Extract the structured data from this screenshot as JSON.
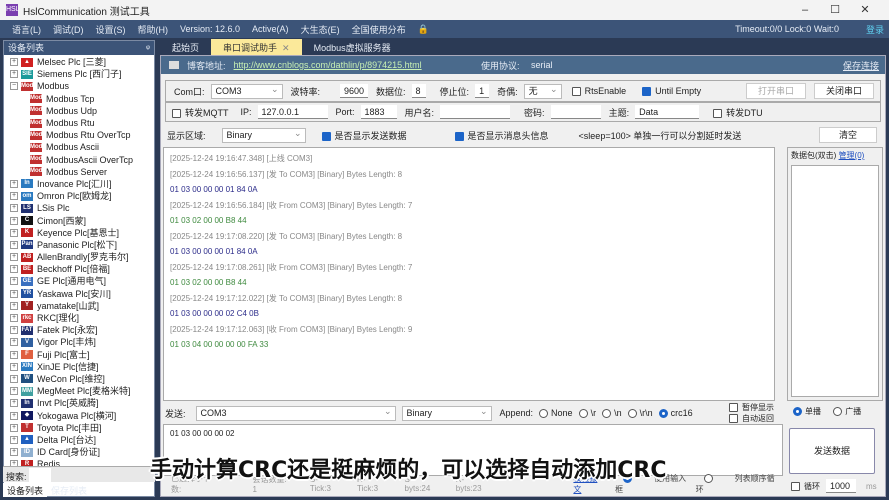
{
  "window": {
    "title": "HslCommunication 测试工具",
    "logo": "HSL",
    "minimize": "–",
    "maximize": "☐",
    "close": "✕"
  },
  "menu": {
    "items": [
      "语言(L)",
      "调试(D)",
      "设置(S)",
      "帮助(H)",
      "Version: 12.6.0",
      "Active(A)",
      "大生态(E)",
      "全国使用分布"
    ],
    "lock_icon": "🔒",
    "status": "Timeout:0/0  Lock:0  Wait:0",
    "login": "登录"
  },
  "tabs": [
    {
      "label": "起始页"
    },
    {
      "label": "串口调试助手",
      "close": "✕"
    },
    {
      "label": "Modbus虚拟服务器"
    }
  ],
  "left_panel": {
    "title": "设备列表",
    "pin": "ᵠ",
    "tree": [
      {
        "label": "Melsec Plc [三菱]",
        "exp": "+",
        "icon": "▲",
        "color": "#d02020"
      },
      {
        "label": "Siemens Plc [西门子]",
        "exp": "+",
        "icon": "SIE",
        "color": "#1a9a9a"
      },
      {
        "label": "Modbus",
        "exp": "−",
        "icon": "Mod",
        "color": "#c03030"
      },
      {
        "label": "Modbus Tcp",
        "child": true,
        "icon": "Mod",
        "color": "#c03030"
      },
      {
        "label": "Modbus Udp",
        "child": true,
        "icon": "Mod",
        "color": "#c03030"
      },
      {
        "label": "Modbus Rtu",
        "child": true,
        "icon": "Mod",
        "color": "#c03030"
      },
      {
        "label": "Modbus Rtu OverTcp",
        "child": true,
        "icon": "Mod",
        "color": "#c03030"
      },
      {
        "label": "Modbus Ascii",
        "child": true,
        "icon": "Mod",
        "color": "#c03030"
      },
      {
        "label": "ModbusAscii OverTcp",
        "child": true,
        "icon": "Mod",
        "color": "#c03030"
      },
      {
        "label": "Modbus Server",
        "child": true,
        "icon": "Mod",
        "color": "#c03030"
      },
      {
        "label": "Inovance Plc[汇川]",
        "exp": "+",
        "icon": "In",
        "color": "#2a7ac0"
      },
      {
        "label": "Omron Plc[欧姆龙]",
        "exp": "+",
        "icon": "om",
        "color": "#2a7ac0"
      },
      {
        "label": "LSis Plc",
        "exp": "+",
        "icon": "LS",
        "color": "#203070"
      },
      {
        "label": "Cimon[西蒙]",
        "exp": "+",
        "icon": "C",
        "color": "#111"
      },
      {
        "label": "Keyence Plc[基恩士]",
        "exp": "+",
        "icon": "K",
        "color": "#c02020"
      },
      {
        "label": "Panasonic Plc[松下]",
        "exp": "+",
        "icon": "Pan",
        "color": "#203880"
      },
      {
        "label": "AllenBrandly[罗克韦尔]",
        "exp": "+",
        "icon": "AB",
        "color": "#c02020"
      },
      {
        "label": "Beckhoff Plc[倍福]",
        "exp": "+",
        "icon": "BE",
        "color": "#c02020"
      },
      {
        "label": "GE Plc[通用电气]",
        "exp": "+",
        "icon": "GE",
        "color": "#3a70c0"
      },
      {
        "label": "Yaskawa Plc[安川]",
        "exp": "+",
        "icon": "YR",
        "color": "#2050a0"
      },
      {
        "label": "yamatake[山武]",
        "exp": "+",
        "icon": "Y",
        "color": "#a02020"
      },
      {
        "label": "RKC[理化]",
        "exp": "+",
        "icon": "rkc",
        "color": "#d04040"
      },
      {
        "label": "Fatek Plc[永宏]",
        "exp": "+",
        "icon": "FAT",
        "color": "#203070"
      },
      {
        "label": "Vigor Plc[丰炜]",
        "exp": "+",
        "icon": "V",
        "color": "#3060a0"
      },
      {
        "label": "Fuji Plc[富士]",
        "exp": "+",
        "icon": "F",
        "color": "#e06040"
      },
      {
        "label": "XinJE Plc[信捷]",
        "exp": "+",
        "icon": "XIN",
        "color": "#2a7ac0"
      },
      {
        "label": "WeCon Plc[维控]",
        "exp": "+",
        "icon": "W",
        "color": "#205080"
      },
      {
        "label": "MegMeet Plc[麦格米特]",
        "exp": "+",
        "icon": "MM",
        "color": "#40a0a0"
      },
      {
        "label": "Invt Plc[英威腾]",
        "exp": "+",
        "icon": "In",
        "color": "#203070"
      },
      {
        "label": "Yokogawa Plc[横河]",
        "exp": "+",
        "icon": "◆",
        "color": "#101860"
      },
      {
        "label": "Toyota Plc[丰田]",
        "exp": "+",
        "icon": "T",
        "color": "#c03030"
      },
      {
        "label": "Delta Plc[台达]",
        "exp": "+",
        "icon": "▲",
        "color": "#2060c0"
      },
      {
        "label": "ID Card[身份证]",
        "exp": "+",
        "icon": "ID",
        "color": "#90b0d0"
      },
      {
        "label": "Redis",
        "exp": "+",
        "icon": "R",
        "color": "#c02020"
      }
    ],
    "search_label": "搜索:",
    "tabs": [
      "设备列表",
      "保存列表"
    ]
  },
  "info": {
    "blog_label": "博客地址:",
    "blog_url": "http://www.cnblogs.com/dathlin/p/8974215.html",
    "protocol_label": "使用协议:",
    "protocol": "serial",
    "save_link": "保存连接"
  },
  "serial": {
    "com_label": "Com口:",
    "com": "COM3",
    "baud_label": "波特率:",
    "baud": "9600",
    "data_label": "数据位:",
    "data_bits": "8",
    "stop_label": "停止位:",
    "stop_bits": "1",
    "parity_label": "奇偶:",
    "parity": "无",
    "rts": "RtsEnable",
    "until_empty": "Until Empty",
    "open": "打开串口",
    "close": "关闭串口"
  },
  "mqtt": {
    "forward": "转发MQTT",
    "ip_label": "IP:",
    "ip": "127.0.0.1",
    "port_label": "Port:",
    "port": "1883",
    "user_label": "用户名:",
    "user": "",
    "pwd_label": "密码:",
    "pwd": "",
    "topic_label": "主题:",
    "topic": "Data",
    "dtu": "转发DTU"
  },
  "display": {
    "label": "显示区域:",
    "mode": "Binary",
    "show_send": "是否显示发送数据",
    "show_head": "是否显示消息头信息",
    "hint": "<sleep=100> 单独一行可以分割延时发送",
    "clear": "清空"
  },
  "log": [
    {
      "t": "meta",
      "text": "[2025-12-24 19:16:47.348] [上线 COM3]"
    },
    {
      "t": "meta",
      "text": "[2025-12-24 19:16:56.137] [发 To COM3]  [Binary]  Bytes Length: 8"
    },
    {
      "t": "tx",
      "text": "01 03 00 00 00 01 84 0A"
    },
    {
      "t": "meta",
      "text": "[2025-12-24 19:16:56.184] [收 From COM3]  [Binary]  Bytes Length: 7"
    },
    {
      "t": "rx",
      "text": "01 03 02 00 00 B8 44"
    },
    {
      "t": "meta",
      "text": "[2025-12-24 19:17:08.220] [发 To COM3]  [Binary]  Bytes Length: 8"
    },
    {
      "t": "tx",
      "text": "01 03 00 00 00 01 84 0A"
    },
    {
      "t": "meta",
      "text": "[2025-12-24 19:17:08.261] [收 From COM3]  [Binary]  Bytes Length: 7"
    },
    {
      "t": "rx",
      "text": "01 03 02 00 00 B8 44"
    },
    {
      "t": "meta",
      "text": "[2025-12-24 19:17:12.022] [发 To COM3]  [Binary]  Bytes Length: 8"
    },
    {
      "t": "tx",
      "text": "01 03 00 00 00 02 C4 0B"
    },
    {
      "t": "meta",
      "text": "[2025-12-24 19:17:12.063] [收 From COM3]  [Binary]  Bytes Length: 9"
    },
    {
      "t": "rx",
      "text": "01 03 04 00 00 00 00 FA 33"
    }
  ],
  "packets": {
    "label": "数据包(双击)",
    "manage": "管理(0)"
  },
  "send": {
    "label": "发送:",
    "target": "COM3",
    "format": "Binary",
    "append_label": "Append:",
    "append_options": [
      "None",
      "\\r",
      "\\n",
      "\\r\\n",
      "crc16"
    ],
    "append_selected": "crc16",
    "pause": "暂停显示",
    "auto_return": "自动返回",
    "text": "01 03 00 00 00 02",
    "unicast": "单播",
    "broadcast": "广播",
    "send_btn": "发送数据",
    "loop": "循环",
    "interval": "1000",
    "ms": "ms",
    "check_link": "校验报文",
    "use_input": "使用输入框",
    "list_loop": "列表顺序循环"
  },
  "status": {
    "selected": "已选择字节数:",
    "sessions": "会话数量: 1",
    "s_tick": "S-Tick:3",
    "r_tick": "R-Tick:3",
    "s_bytes": "S-byts:24",
    "r_bytes": "R-byts:23"
  },
  "subtitle": "手动计算CRC还是挺麻烦的，可以选择自动添加CRC"
}
